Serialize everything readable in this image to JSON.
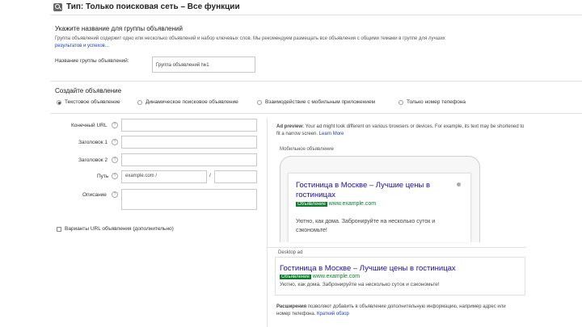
{
  "header": {
    "title": "Тип:  Только поисковая сеть – Все функции"
  },
  "group": {
    "heading": "Укажите название для группы объявлений",
    "desc": "Группа объявлений содержит одно или несколько объявлений и набор ключевых слов. Мы рекомендуем размещать все объявления с общими темами в группе для лучших",
    "desc_link": "результатов и успехов...",
    "name_label": "Название группы объявлений:",
    "name_value": "Группа объявлений №1"
  },
  "create": {
    "heading": "Создайте объявление",
    "radios": [
      {
        "label": "Текстовое объявление",
        "selected": true
      },
      {
        "label": "Динамическое поисковое объявление",
        "selected": false
      },
      {
        "label": "Взаимодействие с мобильным приложением",
        "selected": false
      },
      {
        "label": "Только номер телефона",
        "selected": false
      }
    ]
  },
  "form": {
    "final_url_label": "Конечный URL",
    "headline1_label": "Заголовок 1",
    "headline2_label": "Заголовок 2",
    "path_label": "Путь",
    "path_prefix": "example.com /",
    "path_sep": "/",
    "description_label": "Описание",
    "url_options": "Варианты URL объявления (дополнительно)"
  },
  "preview": {
    "intro_bold": "Ad preview:",
    "intro": " Your ad might look different on various browsers or devices. For example, its text may be shortened to fit a narrow screen.",
    "intro_link": "Learn More",
    "mobile_label": "Мобильное объявление",
    "ad_title": "Гостиница в Москве – Лучшие цены в гостиницах",
    "ad_badge": "Объявление",
    "ad_url": "www.example.com",
    "ad_desc": "Уютно, как дома. Забронируйте на несколько суток и сэкономьте!",
    "desktop_label": "Desktop ad",
    "ext_bold": "Расширения",
    "ext_text": " позволяют добавить в объявление дополнительную информацию, например адрес или номер телефона.",
    "ext_link": "Краткий обзор"
  }
}
